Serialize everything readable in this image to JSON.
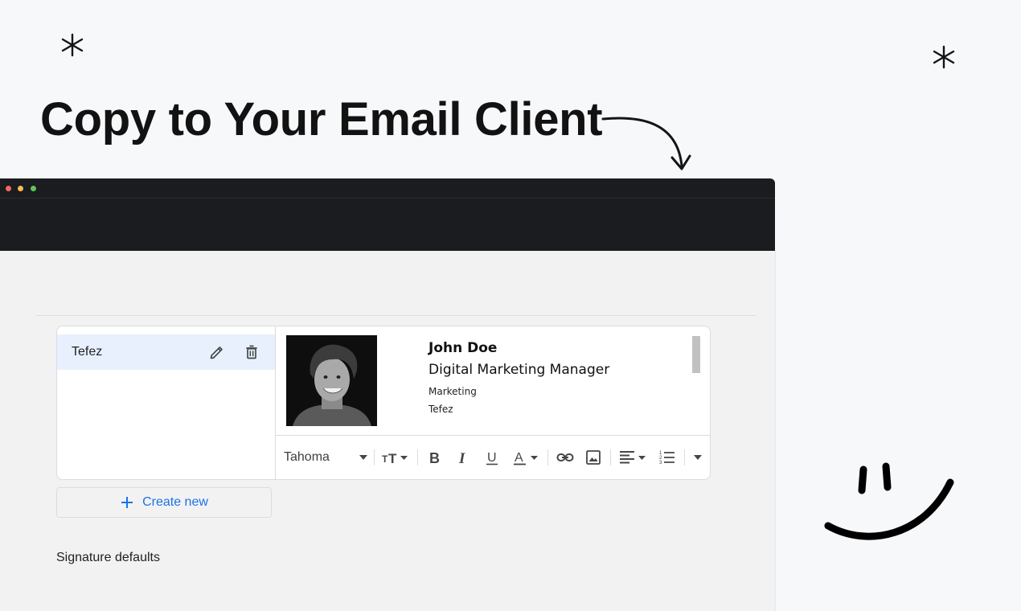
{
  "headline": "Copy to Your Email Client",
  "signatures": {
    "items": [
      {
        "name": "Tefez"
      }
    ],
    "create_new_label": "Create new",
    "defaults_label": "Signature defaults"
  },
  "signature_preview": {
    "name": "John Doe",
    "title": "Digital Marketing Manager",
    "department": "Marketing",
    "company": "Tefez"
  },
  "format_toolbar": {
    "font": "Tahoma",
    "icons": [
      "text-size-icon",
      "bold-icon",
      "italic-icon",
      "underline-icon",
      "text-color-icon",
      "link-icon",
      "image-icon",
      "align-icon",
      "numbered-list-icon",
      "more-options-icon"
    ]
  },
  "colors": {
    "headline": "#121212",
    "window_dark": "#1b1c1f",
    "selected_item": "#e8f0fe",
    "link_blue": "#1a73e8"
  }
}
